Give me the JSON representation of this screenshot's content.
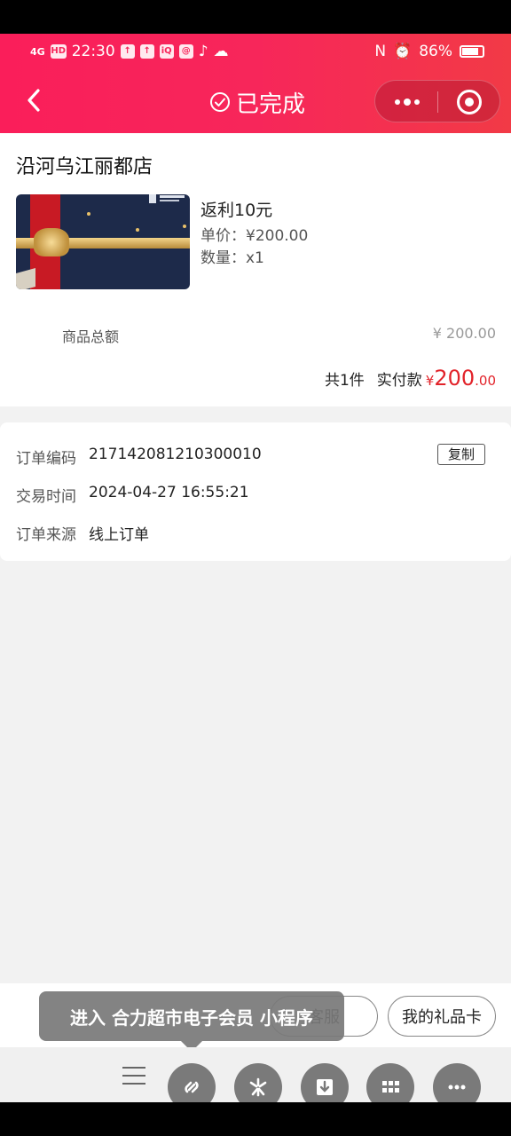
{
  "status_bar": {
    "network": "4G",
    "hd": "HD",
    "time": "22:30",
    "battery": "86%"
  },
  "header": {
    "title": "已完成"
  },
  "order": {
    "store_name": "沿河乌江丽都店",
    "product": {
      "name": "返利10元",
      "unit_price": "单价：¥200.00",
      "quantity": "数量：x1"
    },
    "total_label": "商品总额",
    "total_value": "¥ 200.00",
    "count_text": "共1件",
    "paid_label": "实付款",
    "paid_currency": "¥",
    "paid_main": "200",
    "paid_cents": ".00"
  },
  "details": {
    "order_no_label": "订单编码",
    "order_no_value": "217142081210300010",
    "copy_label": "复制",
    "time_label": "交易时间",
    "time_value": "2024-04-27 16:55:21",
    "source_label": "订单来源",
    "source_value": "线上订单"
  },
  "actions": {
    "service_label": "客服",
    "giftcard_label": "我的礼品卡"
  },
  "tooltip": {
    "text": "进入 合力超市电子会员 小程序"
  },
  "colors": {
    "header_start": "#fa1e5a",
    "header_end": "#f23a46",
    "price_red": "#e2232a"
  },
  "icons": [
    "back-icon",
    "check-circle-icon",
    "more-dots-icon",
    "target-icon",
    "link-icon",
    "sparkle-icon",
    "download-icon",
    "grid-icon",
    "more-icon",
    "menu-icon"
  ]
}
